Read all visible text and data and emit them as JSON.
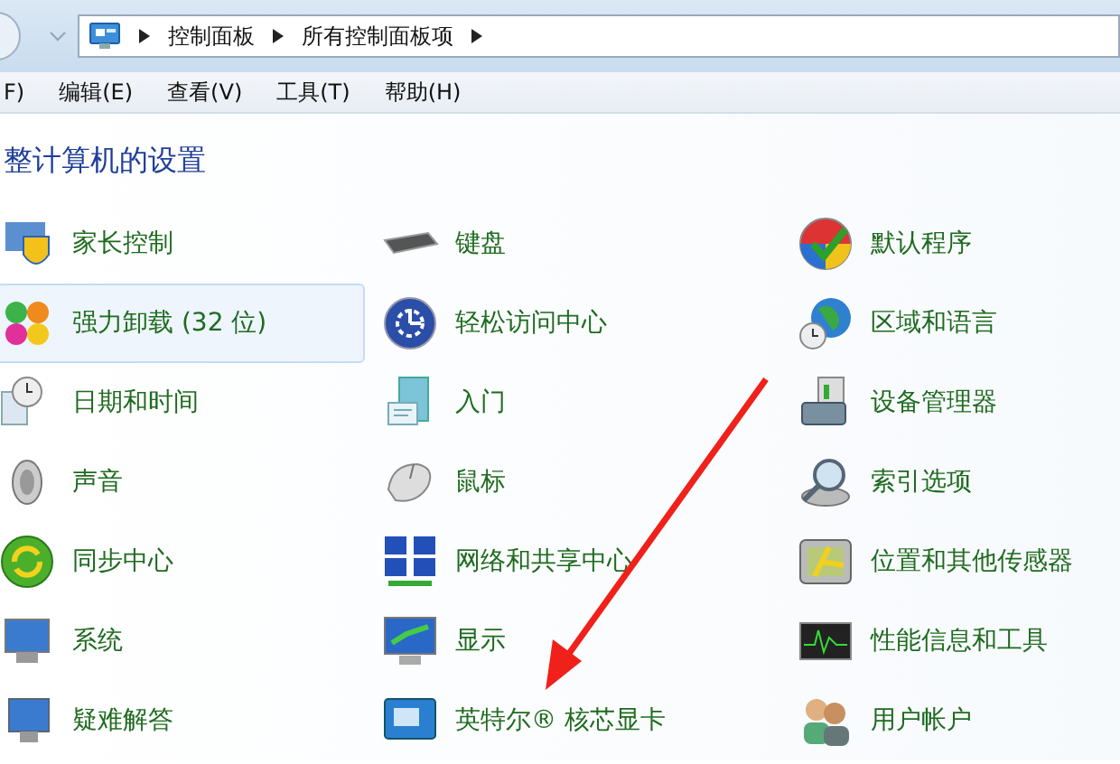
{
  "address_bar": {
    "breadcrumbs": [
      "控制面板",
      "所有控制面板项"
    ]
  },
  "menu": [
    "F)",
    "编辑(E)",
    "查看(V)",
    "工具(T)",
    "帮助(H)"
  ],
  "heading": "整计算机的设置",
  "items": [
    {
      "label": "家长控制",
      "selected": false
    },
    {
      "label": "键盘",
      "selected": false
    },
    {
      "label": "默认程序",
      "selected": false
    },
    {
      "label": "强力卸载 (32 位)",
      "selected": true
    },
    {
      "label": "轻松访问中心",
      "selected": false
    },
    {
      "label": "区域和语言",
      "selected": false
    },
    {
      "label": "日期和时间",
      "selected": false
    },
    {
      "label": "入门",
      "selected": false
    },
    {
      "label": "设备管理器",
      "selected": false
    },
    {
      "label": "声音",
      "selected": false
    },
    {
      "label": "鼠标",
      "selected": false
    },
    {
      "label": "索引选项",
      "selected": false
    },
    {
      "label": "同步中心",
      "selected": false
    },
    {
      "label": "网络和共享中心",
      "selected": false
    },
    {
      "label": "位置和其他传感器",
      "selected": false
    },
    {
      "label": "系统",
      "selected": false
    },
    {
      "label": "显示",
      "selected": false
    },
    {
      "label": "性能信息和工具",
      "selected": false
    },
    {
      "label": "疑难解答",
      "selected": false
    },
    {
      "label": "英特尔® 核芯显卡",
      "selected": false
    },
    {
      "label": "用户帐户",
      "selected": false
    }
  ]
}
